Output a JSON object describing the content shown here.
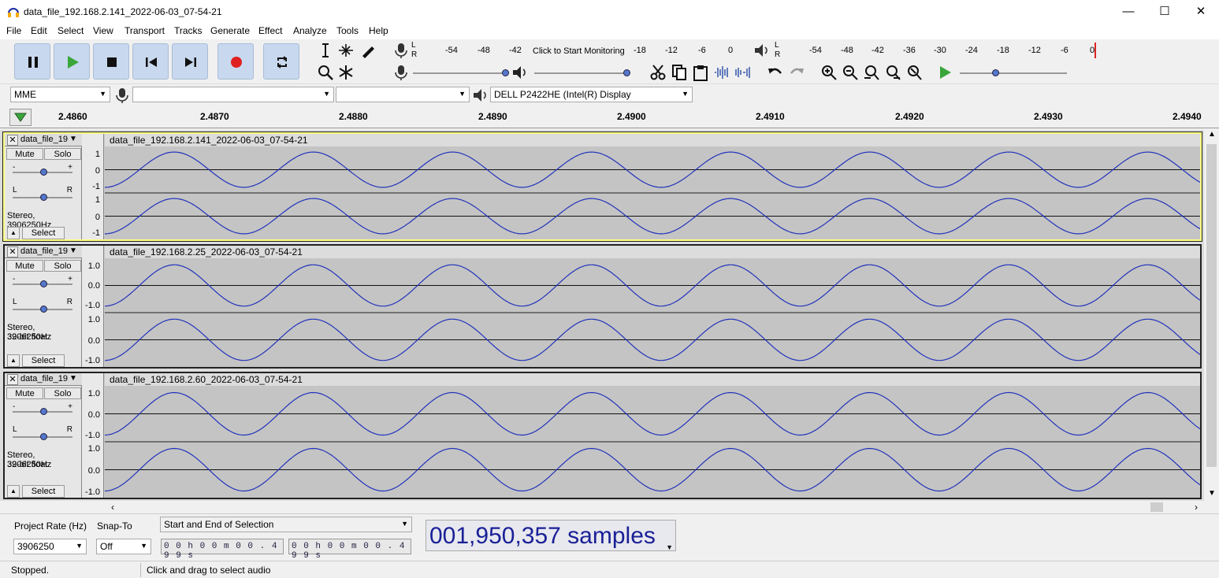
{
  "window": {
    "title": "data_file_192.168.2.141_2022-06-03_07-54-21",
    "minimize": "—",
    "maximize": "☐",
    "close": "✕"
  },
  "menu": [
    "File",
    "Edit",
    "Select",
    "View",
    "Transport",
    "Tracks",
    "Generate",
    "Effect",
    "Analyze",
    "Tools",
    "Help"
  ],
  "transport": {
    "pause": "pause-icon",
    "play": "play-icon",
    "stop": "stop-icon",
    "skip_start": "skip-to-start-icon",
    "skip_end": "skip-to-end-icon",
    "record": "record-icon",
    "loop": "loop-icon"
  },
  "meters": {
    "rec_ticks": [
      "-54",
      "-48",
      "-42",
      "Click to Start Monitoring",
      "-18",
      "-12",
      "-6",
      "0"
    ],
    "play_ticks": [
      "-54",
      "-48",
      "-42",
      "-36",
      "-30",
      "-24",
      "-18",
      "-12",
      "-6",
      "0"
    ],
    "lr": [
      "L",
      "R"
    ]
  },
  "devices": {
    "host": "MME",
    "rec_device": "",
    "rec_channels": "",
    "play_device": "DELL P2422HE (Intel(R) Display"
  },
  "ruler": {
    "ticks": [
      "2.4860",
      "2.4870",
      "2.4880",
      "2.4890",
      "2.4900",
      "2.4910",
      "2.4920",
      "2.4930",
      "2.4940"
    ]
  },
  "tracks": [
    {
      "short": "data_file_19",
      "clip": "data_file_192.168.2.141_2022-06-03_07-54-21",
      "mute": "Mute",
      "solo": "Solo",
      "info1": "Stereo, 3906250Hz",
      "info2": "",
      "select": "Select",
      "scale": [
        "1",
        "0",
        "-1",
        "1",
        "0",
        "-1"
      ]
    },
    {
      "short": "data_file_19",
      "clip": "data_file_192.168.2.25_2022-06-03_07-54-21",
      "mute": "Mute",
      "solo": "Solo",
      "info1": "Stereo, 3906250Hz",
      "info2": "32-bit float",
      "select": "Select",
      "scale": [
        "1.0",
        "0.0",
        "-1.0",
        "1.0",
        "0.0",
        "-1.0"
      ]
    },
    {
      "short": "data_file_19",
      "clip": "data_file_192.168.2.60_2022-06-03_07-54-21",
      "mute": "Mute",
      "solo": "Solo",
      "info1": "Stereo, 3906250Hz",
      "info2": "32-bit float",
      "select": "Select",
      "scale": [
        "1.0",
        "0.0",
        "-1.0",
        "1.0",
        "0.0",
        "-1.0"
      ]
    }
  ],
  "gain_pan": {
    "minus": "-",
    "plus": "+",
    "l": "L",
    "r": "R"
  },
  "selection": {
    "rate_label": "Project Rate (Hz)",
    "rate": "3906250",
    "snap_label": "Snap-To",
    "snap": "Off",
    "mode": "Start and End of Selection",
    "start": "0 0 h 0 0 m 0 0 . 4 9 9 s",
    "end": "0 0 h 0 0 m 0 0 . 4 9 9 s",
    "position": "001,950,357 samples"
  },
  "status": {
    "state": "Stopped.",
    "hint": "Click and drag to select audio"
  },
  "colors": {
    "wave": "#2233bb",
    "bg": "#cbcbcb",
    "accent": "#c8d8ee"
  }
}
